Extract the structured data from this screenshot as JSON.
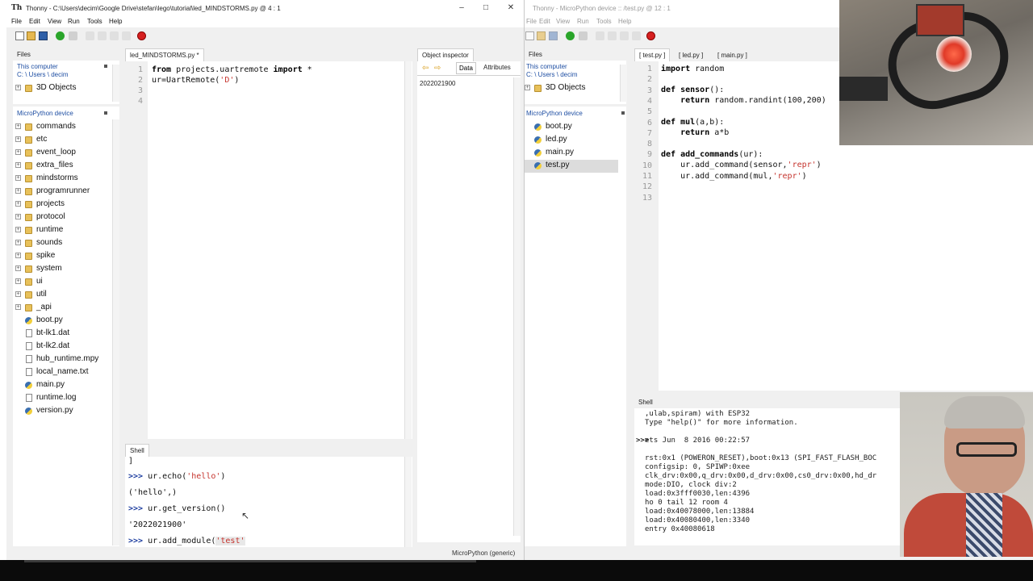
{
  "left_window": {
    "title": "Thonny  -  C:\\Users\\decim\\Google Drive\\stefan\\lego\\tutorial\\led_MINDSTORMS.py  @  4 : 1",
    "menu": [
      "File",
      "Edit",
      "View",
      "Run",
      "Tools",
      "Help"
    ],
    "files_tab": "Files",
    "this_computer_label": "This computer",
    "this_computer_path": "C: \\ Users \\ decim",
    "computer_items": [
      {
        "label": "3D Objects",
        "type": "folder"
      }
    ],
    "micropython_label": "MicroPython device",
    "device_items": [
      {
        "label": "commands",
        "type": "folder"
      },
      {
        "label": "etc",
        "type": "folder"
      },
      {
        "label": "event_loop",
        "type": "folder"
      },
      {
        "label": "extra_files",
        "type": "folder"
      },
      {
        "label": "mindstorms",
        "type": "folder"
      },
      {
        "label": "programrunner",
        "type": "folder"
      },
      {
        "label": "projects",
        "type": "folder"
      },
      {
        "label": "protocol",
        "type": "folder"
      },
      {
        "label": "runtime",
        "type": "folder"
      },
      {
        "label": "sounds",
        "type": "folder"
      },
      {
        "label": "spike",
        "type": "folder"
      },
      {
        "label": "system",
        "type": "folder"
      },
      {
        "label": "ui",
        "type": "folder"
      },
      {
        "label": "util",
        "type": "folder"
      },
      {
        "label": "_api",
        "type": "folder"
      },
      {
        "label": "boot.py",
        "type": "py"
      },
      {
        "label": "bt-lk1.dat",
        "type": "file"
      },
      {
        "label": "bt-lk2.dat",
        "type": "file"
      },
      {
        "label": "hub_runtime.mpy",
        "type": "file"
      },
      {
        "label": "local_name.txt",
        "type": "file"
      },
      {
        "label": "main.py",
        "type": "py"
      },
      {
        "label": "runtime.log",
        "type": "file"
      },
      {
        "label": "version.py",
        "type": "py"
      }
    ],
    "editor_tab": "led_MINDSTORMS.py *",
    "editor_lines": [
      "1",
      "2",
      "3",
      "4"
    ],
    "code": {
      "l1_kw1": "from",
      "l1_mid": " projects.uartremote ",
      "l1_kw2": "import",
      "l1_end": " *",
      "l2_pre": "ur=UartRemote(",
      "l2_str": "'D'",
      "l2_end": ")"
    },
    "object_inspector_tab": "Object inspector",
    "inspector_tabs": [
      "Data",
      "Attributes"
    ],
    "inspector_value": "2022021900",
    "shell_tab": "Shell",
    "shell": {
      "bracket": "]",
      "prompt": ">>>",
      "cmd1_pre": " ur.echo(",
      "cmd1_str": "'hello'",
      "cmd1_end": ")",
      "out1": "('hello',)",
      "cmd2": " ur.get_version()",
      "out2": "'2022021900'",
      "cmd3_pre": " ur.add_module(",
      "cmd3_str": "'test'"
    },
    "status": "MicroPython (generic)"
  },
  "right_window": {
    "title": "Thonny  -  MicroPython device :: /test.py  @  12 : 1",
    "menu": [
      "File",
      "Edit",
      "View",
      "Run",
      "Tools",
      "Help"
    ],
    "files_tab": "Files",
    "this_computer_label": "This computer",
    "this_computer_path": "C: \\ Users \\ decim",
    "computer_items": [
      {
        "label": "3D Objects",
        "type": "folder"
      }
    ],
    "micropython_label": "MicroPython device",
    "device_items": [
      {
        "label": "boot.py",
        "type": "py"
      },
      {
        "label": "led.py",
        "type": "py"
      },
      {
        "label": "main.py",
        "type": "py"
      },
      {
        "label": "test.py",
        "type": "py"
      }
    ],
    "editor_tabs": [
      "[ test.py ]",
      "[ led.py ]",
      "[ main.py ]"
    ],
    "editor_lines": [
      "1",
      "2",
      "3",
      "4",
      "5",
      "6",
      "7",
      "8",
      "9",
      "10",
      "11",
      "12",
      "13"
    ],
    "code": {
      "import_kw": "import",
      "import_rest": " random",
      "def": "def",
      "sensor_name": " sensor",
      "sensor_args": "():",
      "return": "return",
      "sensor_body": " random.randint(100,200)",
      "mul_name": " mul",
      "mul_args": "(a,b):",
      "mul_body": " a*b",
      "addc_name": " add_commands",
      "addc_args": "(ur):",
      "l10_pre": "    ur.add_command(sensor,",
      "l11_pre": "    ur.add_command(mul,",
      "repr": "'repr'",
      "close": ")"
    },
    "shell_tab": "Shell",
    "terminal": [
      ",ulab,spiram) with ESP32",
      "Type \"help()\" for more information.",
      "",
      "ets Jun  8 2016 00:22:57",
      "",
      "rst:0x1 (POWERON_RESET),boot:0x13 (SPI_FAST_FLASH_BOC",
      "configsip: 0, SPIWP:0xee",
      "clk_drv:0x00,q_drv:0x00,d_drv:0x00,cs0_drv:0x00,hd_dr",
      "mode:DIO, clock div:2",
      "load:0x3fff0030,len:4396",
      "ho 0 tail 12 room 4",
      "load:0x40078000,len:13884",
      "load:0x40080400,len:3340",
      "entry 0x40080618"
    ],
    "terminal_prompt": ">>>"
  }
}
